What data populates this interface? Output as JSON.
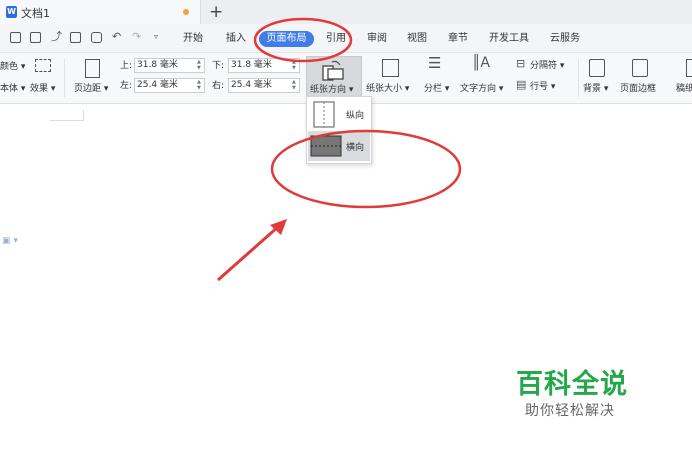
{
  "tab": {
    "title": "文档1",
    "new_tab": "+"
  },
  "menu": {
    "items": [
      "开始",
      "插入",
      "页面布局",
      "引用",
      "审阅",
      "视图",
      "章节",
      "开发工具",
      "云服务"
    ],
    "active_index": 2
  },
  "ribbon": {
    "left_partial_1": "颜色 ▾",
    "left_partial_2": "本体 ▾",
    "effects": "效果 ▾",
    "margins": "页边距 ▾",
    "top_label": "上:",
    "top_value": "31.8 毫米",
    "bottom_label": "下:",
    "bottom_value": "31.8 毫米",
    "left_label": "左:",
    "left_value": "25.4 毫米",
    "right_label": "右:",
    "right_value": "25.4 毫米",
    "orientation": "纸张方向 ▾",
    "paper_size": "纸张大小 ▾",
    "columns": "分栏 ▾",
    "text_direction": "文字方向 ▾",
    "separator": "分隔符 ▾",
    "line_number": "行号 ▾",
    "background": "背景 ▾",
    "page_border": "页面边框",
    "manuscript_partial": "稿纸"
  },
  "dropdown": {
    "portrait": "纵向",
    "landscape": "横向",
    "selected": "landscape"
  },
  "watermark": {
    "title": "百科全说",
    "subtitle": "助你轻松解决"
  },
  "colors": {
    "accent": "#3f7de8",
    "annotation": "#e03a3a",
    "watermark_green": "#25a74b"
  }
}
